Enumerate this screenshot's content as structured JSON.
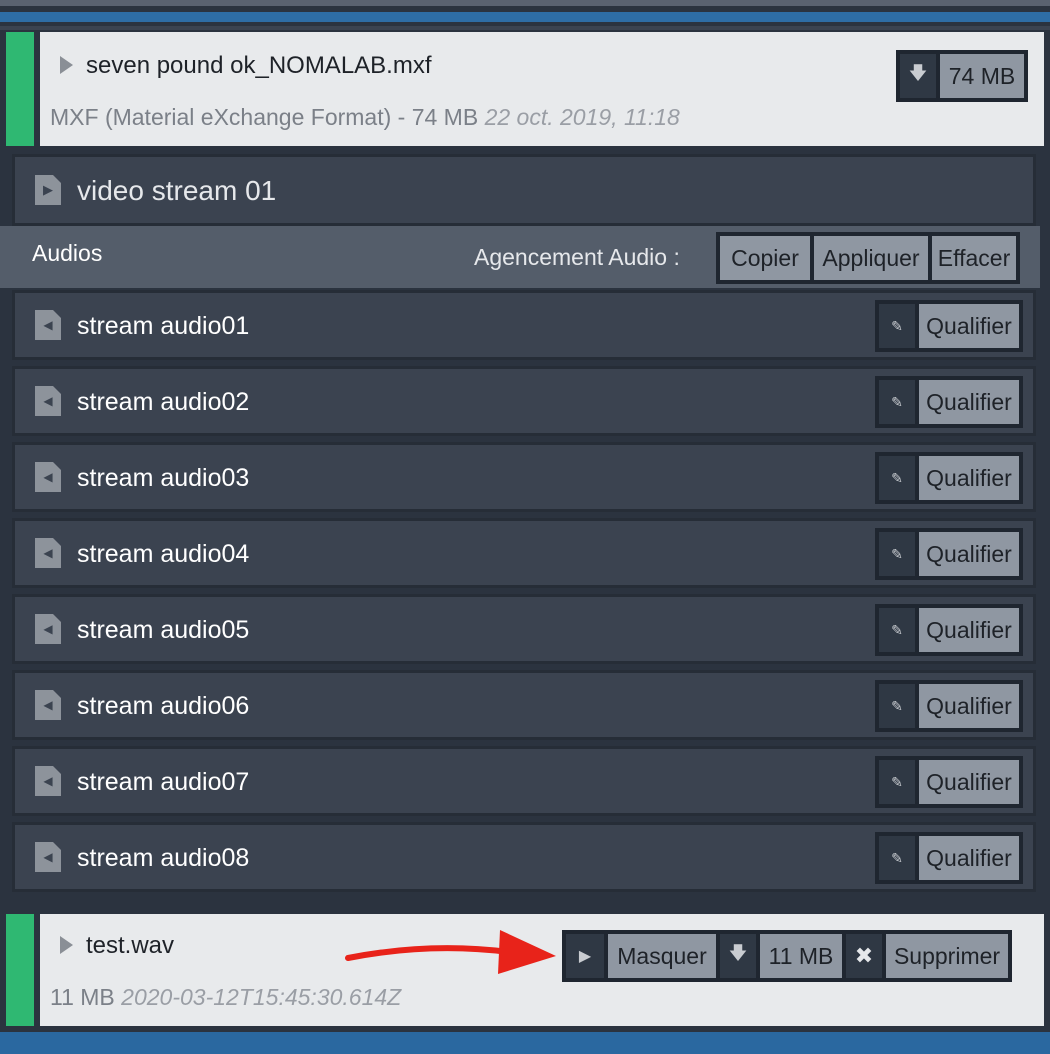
{
  "file1": {
    "name": "seven pound ok_NOMALAB.mxf",
    "info": "MXF (Material eXchange Format) - 74 MB",
    "date": "22 oct. 2019, 11:18",
    "download_icon": "download-icon",
    "size_button": "74 MB"
  },
  "video": {
    "label": "video stream 01",
    "icon": "video-file-icon"
  },
  "audios": {
    "title": "Audios",
    "agencement_label": "Agencement Audio :",
    "buttons": {
      "copy": "Copier",
      "apply": "Appliquer",
      "clear": "Effacer"
    },
    "qualify_label": "Qualifier",
    "edit_icon": "edit-icon",
    "streams": [
      "stream audio01",
      "stream audio02",
      "stream audio03",
      "stream audio04",
      "stream audio05",
      "stream audio06",
      "stream audio07",
      "stream audio08"
    ]
  },
  "file2": {
    "name": "test.wav",
    "info": "11 MB",
    "date": "2020-03-12T15:45:30.614Z",
    "hide_button": "Masquer",
    "size_button": "11 MB",
    "delete_button": "Supprimer",
    "play_icon": "play-icon",
    "download_icon": "download-icon",
    "delete_icon": "close-icon"
  },
  "colors": {
    "accent_green": "#2fb872",
    "accent_blue": "#2e6da5",
    "annotation_red": "#e8231a"
  }
}
